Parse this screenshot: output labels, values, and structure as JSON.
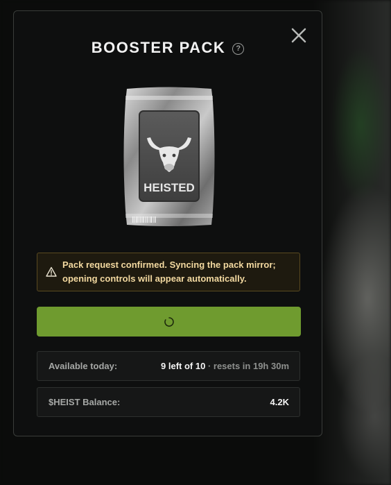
{
  "modal": {
    "title": "BOOSTER PACK",
    "help_icon": "question-circle-icon",
    "close_icon": "close-x-icon"
  },
  "pack": {
    "brand_text": "HEISTED",
    "emblem": "bull-head-icon"
  },
  "notice": {
    "icon": "warning-triangle-icon",
    "message": "Pack request confirmed. Syncing the pack mirror; opening controls will appear automatically."
  },
  "primary_button": {
    "state": "loading",
    "icon": "spinner-icon",
    "color": "#6f9b2f"
  },
  "stats": {
    "available_label": "Available today:",
    "available_value": "9 left of 10",
    "available_reset": " · resets in 19h 30m",
    "balance_label": "$HEIST Balance:",
    "balance_value": "4.2K"
  },
  "colors": {
    "accent_green": "#6f9b2f",
    "warning_text": "#f3d9a0",
    "warning_border": "#5a4a20"
  }
}
